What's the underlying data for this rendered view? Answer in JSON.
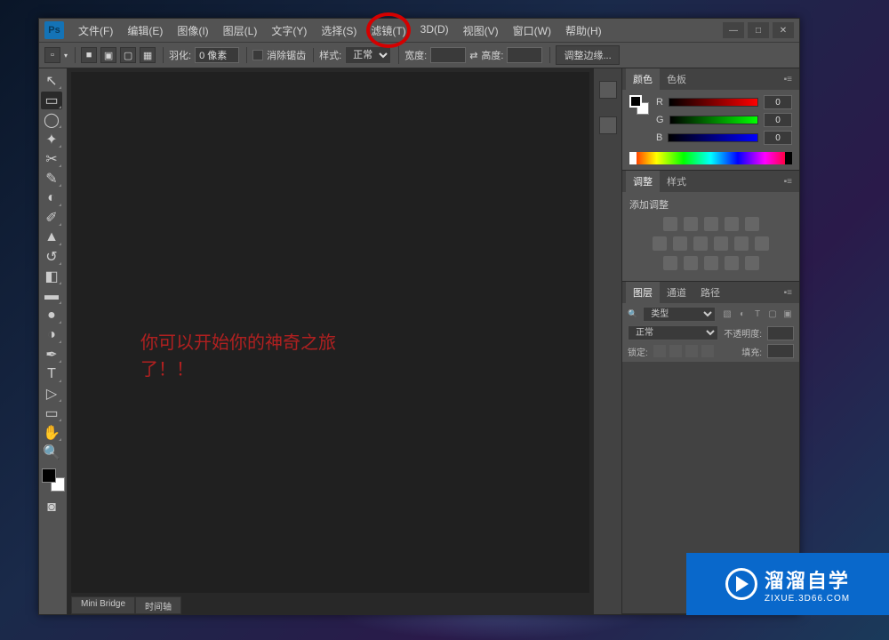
{
  "app": {
    "logo": "Ps"
  },
  "menu": {
    "file": "文件(F)",
    "edit": "编辑(E)",
    "image": "图像(I)",
    "layer": "图层(L)",
    "type": "文字(Y)",
    "select": "选择(S)",
    "filter": "滤镜(T)",
    "threed": "3D(D)",
    "view": "视图(V)",
    "window": "窗口(W)",
    "help": "帮助(H)"
  },
  "options": {
    "feather_label": "羽化:",
    "feather_value": "0 像素",
    "antialias": "消除锯齿",
    "style_label": "样式:",
    "style_value": "正常",
    "width_label": "宽度:",
    "height_label": "高度:",
    "refine_edge": "调整边缘..."
  },
  "canvas": {
    "text_line1": "你可以开始你的神奇之旅",
    "text_line2": "了！！"
  },
  "bottom_tabs": {
    "mini_bridge": "Mini Bridge",
    "timeline": "时间轴"
  },
  "panels": {
    "color": {
      "tab1": "颜色",
      "tab2": "色板",
      "r": "R",
      "g": "G",
      "b": "B",
      "r_val": "0",
      "g_val": "0",
      "b_val": "0"
    },
    "adjustments": {
      "tab1": "调整",
      "tab2": "样式",
      "title": "添加调整"
    },
    "layers": {
      "tab1": "图层",
      "tab2": "通道",
      "tab3": "路径",
      "kind_label": "类型",
      "blend_mode": "正常",
      "opacity_label": "不透明度:",
      "lock_label": "锁定:",
      "fill_label": "填充:"
    }
  },
  "watermark": {
    "main": "溜溜自学",
    "sub": "ZIXUE.3D66.COM"
  }
}
